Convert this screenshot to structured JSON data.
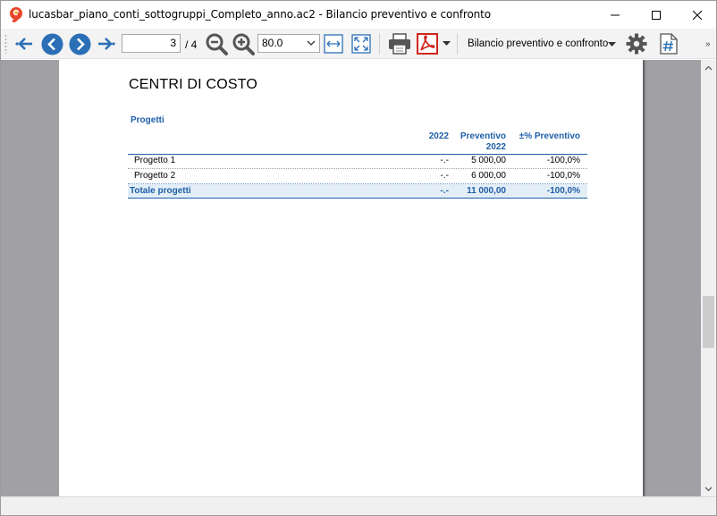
{
  "window": {
    "title": "lucasbar_piano_conti_sottogruppi_Completo_anno.ac2 - Bilancio preventivo e confronto"
  },
  "toolbar": {
    "page_value": "3",
    "page_total": "/ 4",
    "zoom_value": "80.0",
    "report_label": "Bilancio preventivo e confronto",
    "overflow": "»"
  },
  "report": {
    "title": "CENTRI DI COSTO",
    "section": "Progetti",
    "columns": {
      "col_2022": "2022",
      "col_preventivo_line1": "Preventivo",
      "col_preventivo_line2": "2022",
      "col_pct": "±% Preventivo"
    },
    "rows": [
      {
        "name": "Progetto 1",
        "y2022": "-.-",
        "preventivo": "5 000,00",
        "pct": "-100,0%"
      },
      {
        "name": "Progetto 2",
        "y2022": "-.-",
        "preventivo": "6 000,00",
        "pct": "-100,0%"
      }
    ],
    "total": {
      "name": "Totale progetti",
      "y2022": "-.-",
      "preventivo": "11 000,00",
      "pct": "-100,0%"
    }
  },
  "colors": {
    "accent_blue": "#1f5fa8",
    "total_row_bg": "#e3eef7",
    "viewer_bg": "#a0a0a5"
  }
}
